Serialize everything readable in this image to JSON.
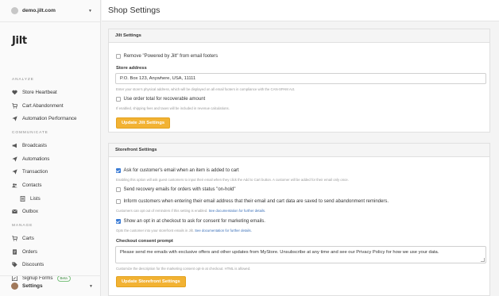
{
  "sidebar": {
    "store": {
      "name": "demo.jilt.com"
    },
    "logo": "Jilt",
    "sections": [
      {
        "label": "Analyze",
        "items": [
          {
            "label": "Store Heartbeat",
            "icon": "heart-icon"
          },
          {
            "label": "Cart Abandonment",
            "icon": "cart-icon"
          },
          {
            "label": "Automation Performance",
            "icon": "paper-plane-icon"
          }
        ]
      },
      {
        "label": "Communicate",
        "items": [
          {
            "label": "Broadcasts",
            "icon": "megaphone-icon"
          },
          {
            "label": "Automations",
            "icon": "paper-plane-icon"
          },
          {
            "label": "Transaction",
            "icon": "receipt-icon"
          },
          {
            "label": "Contacts",
            "icon": "users-icon"
          },
          {
            "label": "Lists",
            "icon": "list-icon"
          },
          {
            "label": "Outbox",
            "icon": "envelope-icon"
          }
        ]
      },
      {
        "label": "Manage",
        "items": [
          {
            "label": "Carts",
            "icon": "cart-icon"
          },
          {
            "label": "Orders",
            "icon": "document-icon"
          },
          {
            "label": "Discounts",
            "icon": "tag-icon"
          },
          {
            "label": "Signup Forms",
            "icon": "form-icon",
            "badge": "Beta"
          }
        ]
      }
    ],
    "footer": {
      "label": "Settings"
    }
  },
  "header": {
    "title": "Shop Settings"
  },
  "jilt_settings": {
    "title": "Jilt Settings",
    "remove_powered_by": {
      "label": "Remove \"Powered by Jilt\" from email footers",
      "checked": false
    },
    "store_address": {
      "label": "Store address",
      "value": "P.O. Box 123, Anywhere, USA, 11111",
      "help": "Enter your store's physical address, which will be displayed on all email footers in compliance with the CAN-SPAM Act."
    },
    "use_order_total": {
      "label": "Use order total for recoverable amount",
      "checked": false,
      "help": "If enabled, shipping fees and taxes will be included in revenue calculations."
    },
    "save_button": "Update Jilt Settings"
  },
  "storefront_settings": {
    "title": "Storefront Settings",
    "ask_email": {
      "label": "Ask for customer's email when an item is added to cart",
      "checked": true,
      "help": "Enabling this option will ask guest customers to input their email when they click the Add to Cart button. A customer will be added for their email only once."
    },
    "send_on_hold": {
      "label": "Send recovery emails for orders with status \"on-hold\"",
      "checked": false
    },
    "inform_customers": {
      "label": "Inform customers when entering their email address that their email and cart data are saved to send abandonment reminders.",
      "checked": false,
      "help": "Customers can opt out of reminders if this setting is enabled.",
      "help_link": "See documentation for further details."
    },
    "opt_in": {
      "label": "Show an opt in at checkout to ask for consent for marketing emails.",
      "checked": true,
      "help": "Opts the customer into your storefront emails in Jilt.",
      "help_link": "See documentation for further details."
    },
    "consent_prompt": {
      "label": "Checkout consent prompt",
      "value": "Please send me emails with exclusive offers and other updates from MyStore. Unsubscribe at any time and see our Privacy Policy for how we use your data.",
      "help": "Customize the description for the marketing consent opt-in at checkout. HTML is allowed."
    },
    "save_button": "Update Storefront Settings"
  },
  "colors": {
    "accent": "#f2b233",
    "link": "#3a6fb8",
    "checkbox": "#3a7bd5"
  }
}
